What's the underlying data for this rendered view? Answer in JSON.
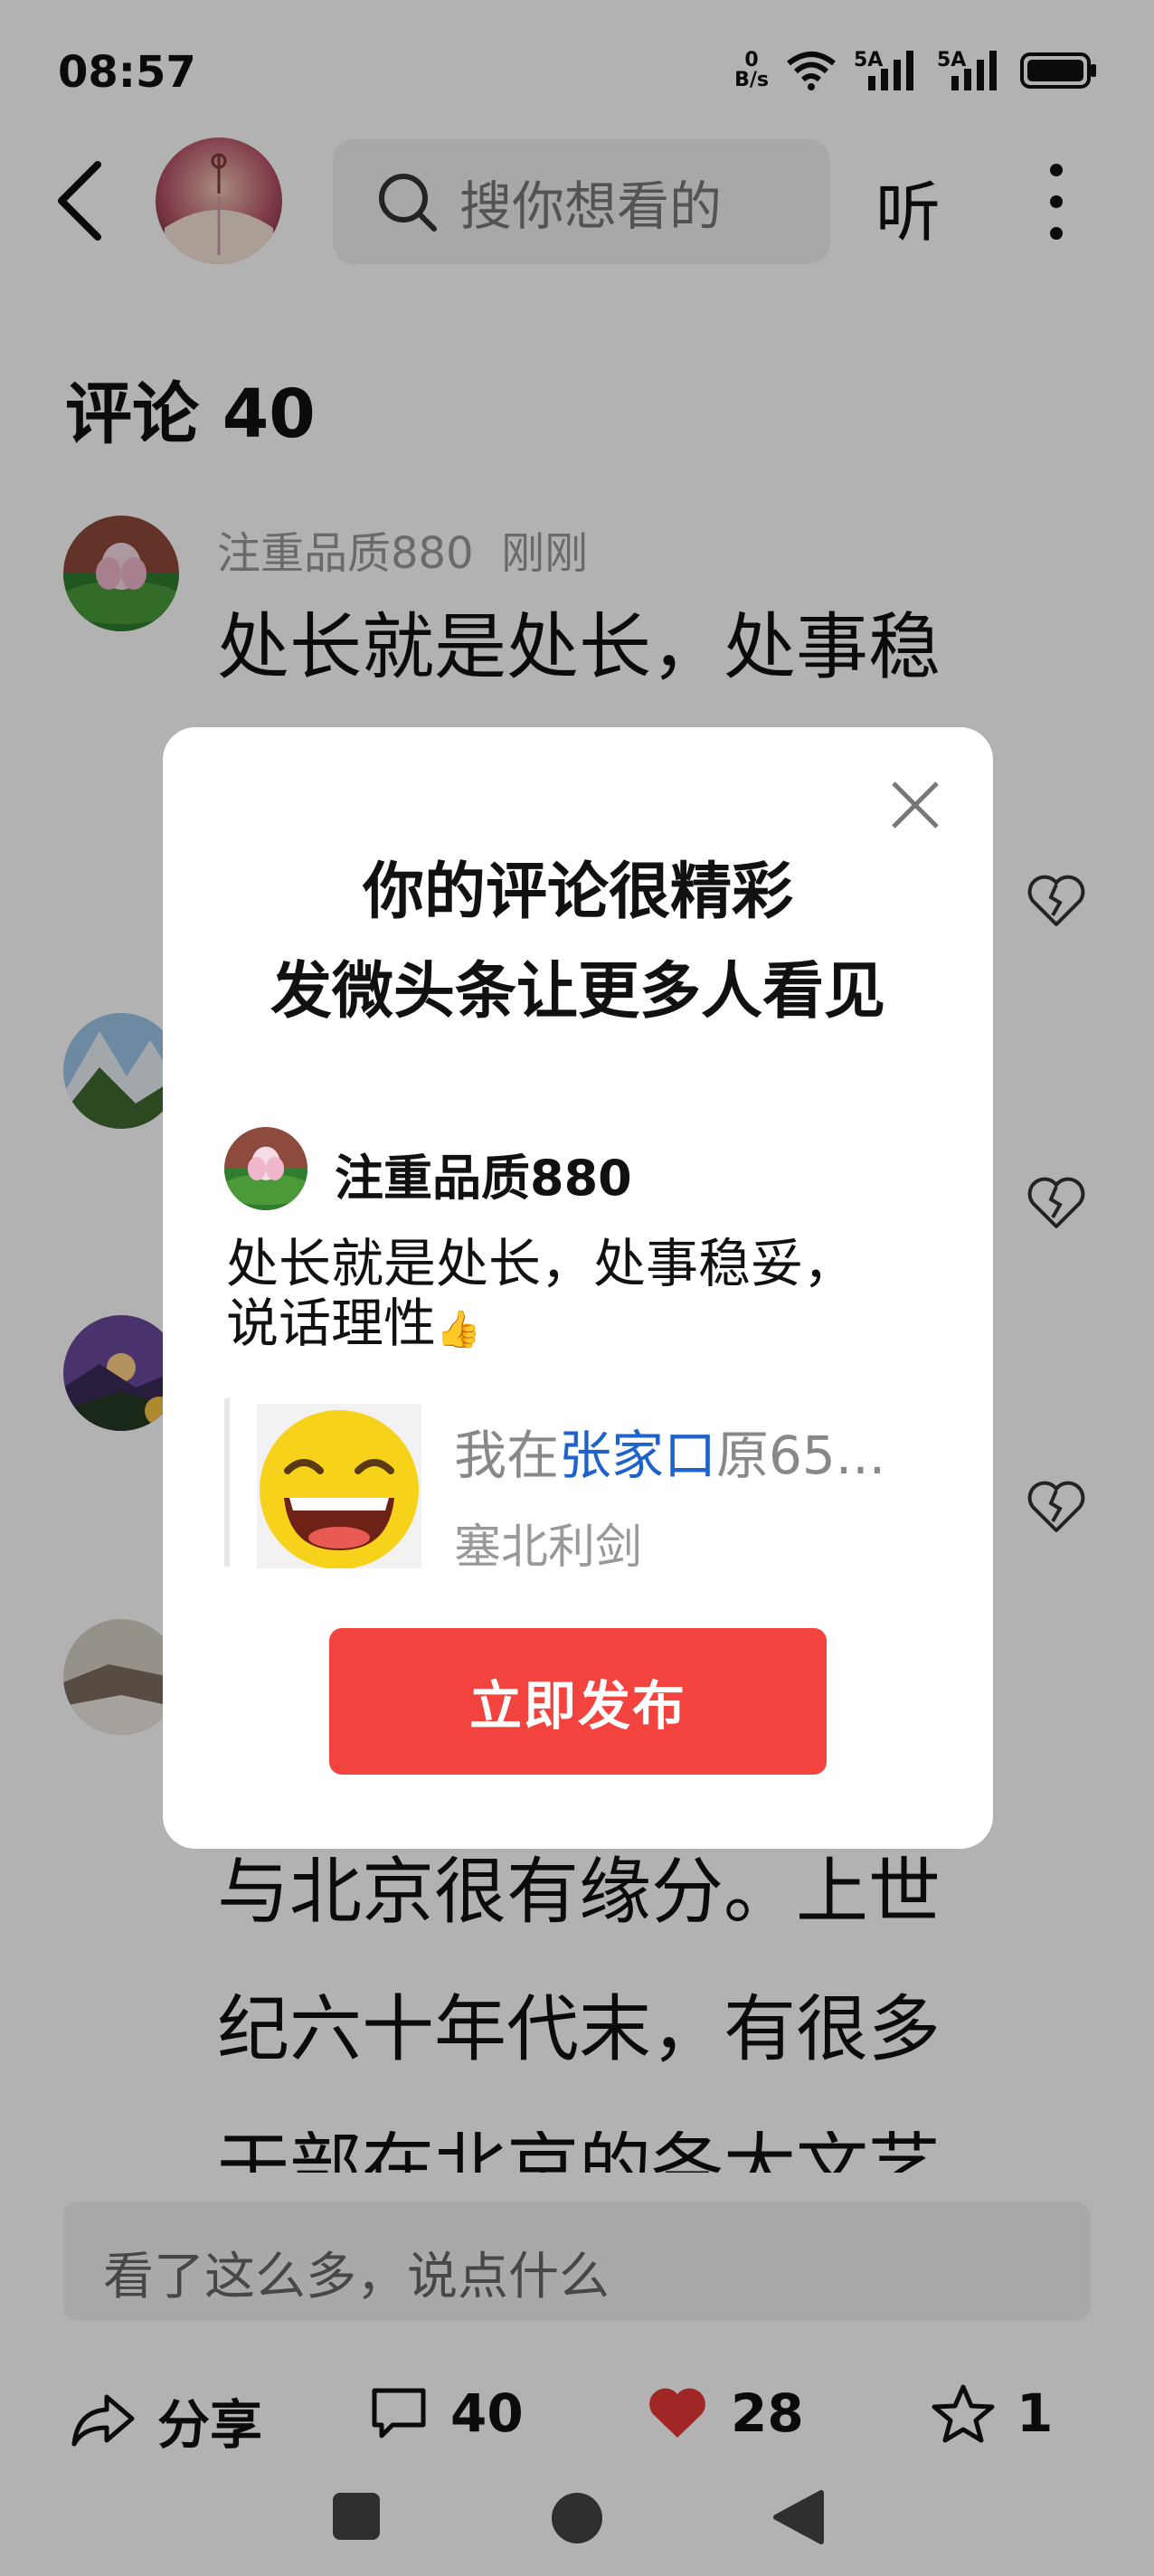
{
  "status": {
    "time": "08:57",
    "net_speed_value": "0",
    "net_speed_unit": "B/s",
    "sim1": "5A",
    "sim2": "5A"
  },
  "top": {
    "search_label": "搜你想看的",
    "listen_label": "听"
  },
  "comments_header": "评论 40",
  "comments": [
    {
      "user": "注重品质880",
      "time": "刚刚",
      "text": "处长就是处长，处事稳"
    }
  ],
  "background_text_lines": [
    "与北京很有缘分。上世",
    "纪六十年代末，有很多",
    "干部在北京的各大文艺"
  ],
  "reply_placeholder": "看了这么多，说点什么",
  "actions": {
    "share_label": "分享",
    "comment_count": "40",
    "like_count": "28",
    "favorite_count": "1"
  },
  "modal": {
    "title_line1": "你的评论很精彩",
    "title_line2": "发微头条让更多人看见",
    "user": "注重品质880",
    "comment_line1": "处长就是处长，处事稳妥，",
    "comment_line2": "说话理性",
    "comment_emoji": "👍",
    "quote_prefix": "我在",
    "quote_highlight": "张家口",
    "quote_suffix": "原65...",
    "quote_author": "塞北利剑",
    "publish_label": "立即发布"
  },
  "colors": {
    "accent_red": "#f3433f",
    "link_blue": "#1f62c9",
    "like_red": "#e53935"
  }
}
